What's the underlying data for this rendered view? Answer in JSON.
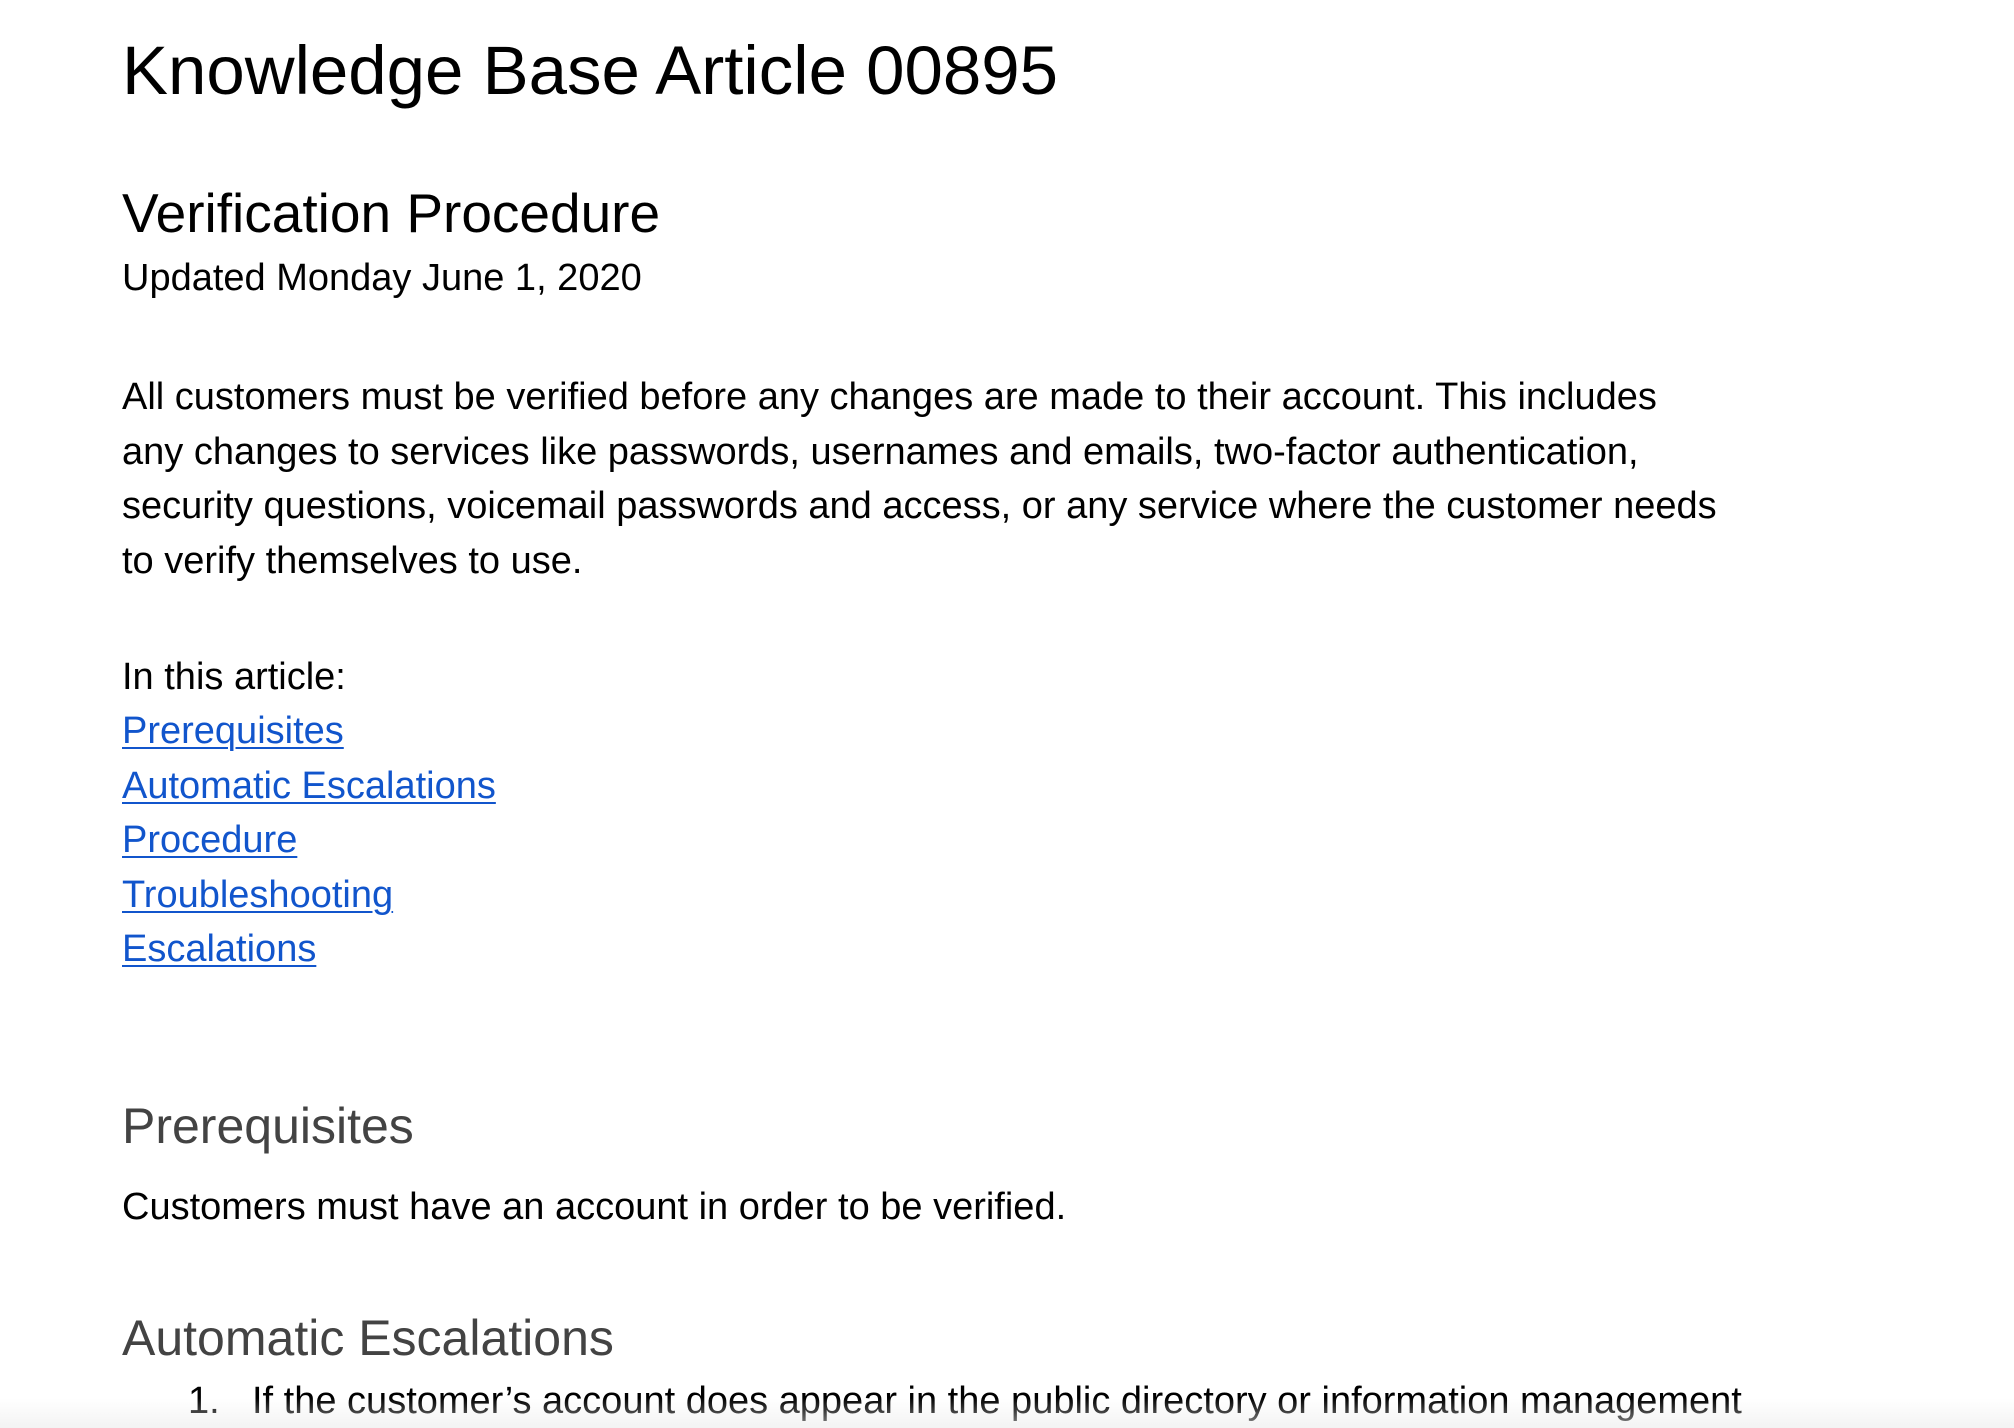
{
  "document": {
    "title": "Knowledge Base Article 00895",
    "subtitle": "Verification Procedure",
    "updated": "Updated Monday June 1, 2020",
    "intro_lines": [
      "All customers must be verified before any changes are made to their account.  This includes",
      "any changes to services like passwords, usernames and emails, two-factor authentication,",
      "security questions, voicemail passwords and access, or any service where the customer needs",
      "to verify themselves to use."
    ],
    "toc_label": "In this article:",
    "toc": [
      "Prerequisites",
      "Automatic Escalations",
      "Procedure",
      "Troubleshooting",
      "Escalations"
    ],
    "sections": {
      "prerequisites": {
        "heading": "Prerequisites",
        "text": "Customers must have an account in order to be verified."
      },
      "automatic_escalations": {
        "heading": "Automatic Escalations",
        "steps": [
          {
            "number": "1.",
            "text": "If the customer’s account does appear in the public directory or information management"
          }
        ]
      }
    }
  },
  "colors": {
    "link": "#1155cc",
    "section_heading": "#434343",
    "text": "#000000",
    "background": "#ffffff"
  }
}
